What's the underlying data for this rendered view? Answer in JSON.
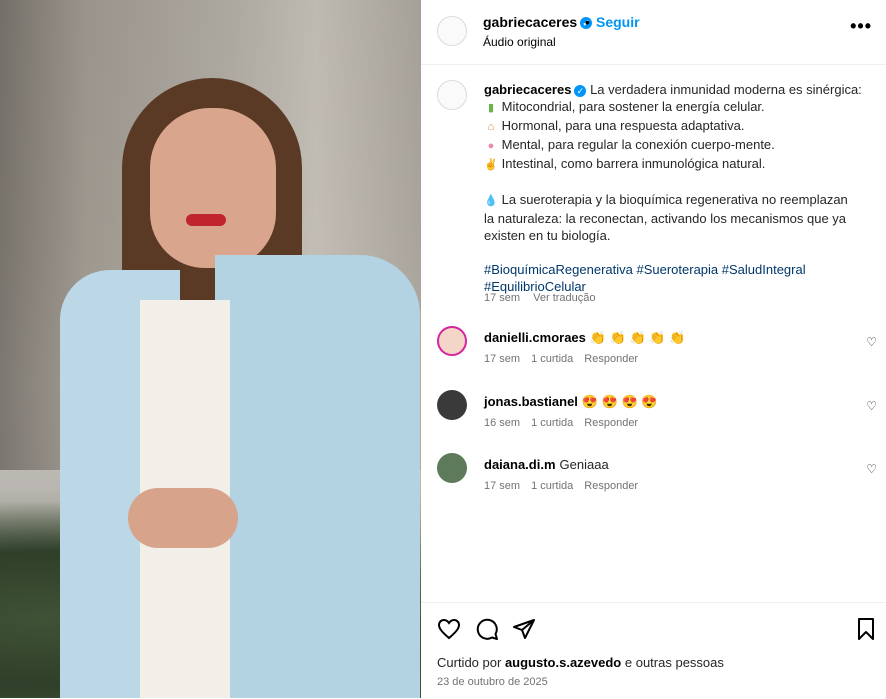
{
  "post": {
    "username": "gabriecaceres",
    "follow_label": "Seguir",
    "separator": "•",
    "audio_label": "Áudio original",
    "more_label": "•••"
  },
  "caption": {
    "username": "gabriecaceres",
    "intro": "La verdadera inmunidad moderna es sinérgica:",
    "items": [
      {
        "icon": "battery-icon",
        "glyph": "▮",
        "text": "Mitocondrial, para sostener la energía celular."
      },
      {
        "icon": "cake-icon",
        "glyph": "⌂",
        "text": "Hormonal, para una respuesta adaptativa."
      },
      {
        "icon": "brain-icon",
        "glyph": "●",
        "text": "Mental, para regular la conexión cuerpo-mente."
      },
      {
        "icon": "leaf-icon",
        "glyph": "✌",
        "text": "Intestinal, como barrera inmunológica natural."
      }
    ],
    "paragraph_icon": "droplet-icon",
    "paragraph_glyph": "💧",
    "paragraph_line1": "La sueroterapia y la bioquímica regenerativa no reemplazan",
    "paragraph_line2": "la naturaleza: la reconectan, activando los mecanismos que ya",
    "paragraph_line3": "existen en tu biología.",
    "hashtags_line1": "#BioquímicaRegenerativa #Sueroterapia #SaludIntegral",
    "hashtags_line2": "#EquilibrioCelular",
    "time": "17 sem",
    "translate": "Ver tradução"
  },
  "comments": [
    {
      "username": "danielli.cmoraes",
      "text": "👏 👏 👏 👏 👏",
      "time": "17 sem",
      "likes": "1 curtida",
      "reply": "Responder"
    },
    {
      "username": "jonas.bastianel",
      "text": "😍 😍 😍 😍",
      "time": "16 sem",
      "likes": "1 curtida",
      "reply": "Responder"
    },
    {
      "username": "daiana.di.m",
      "text": "Geniaaa",
      "time": "17 sem",
      "likes": "1 curtida",
      "reply": "Responder"
    }
  ],
  "footer": {
    "liked_prefix": "Curtido por",
    "liked_user": "augusto.s.azevedo",
    "liked_suffix": "e outras pessoas",
    "date": "23 de outubro de 2025"
  },
  "colors": {
    "accent": "#0095f6",
    "hashtag": "#00376b",
    "muted": "#737373"
  }
}
